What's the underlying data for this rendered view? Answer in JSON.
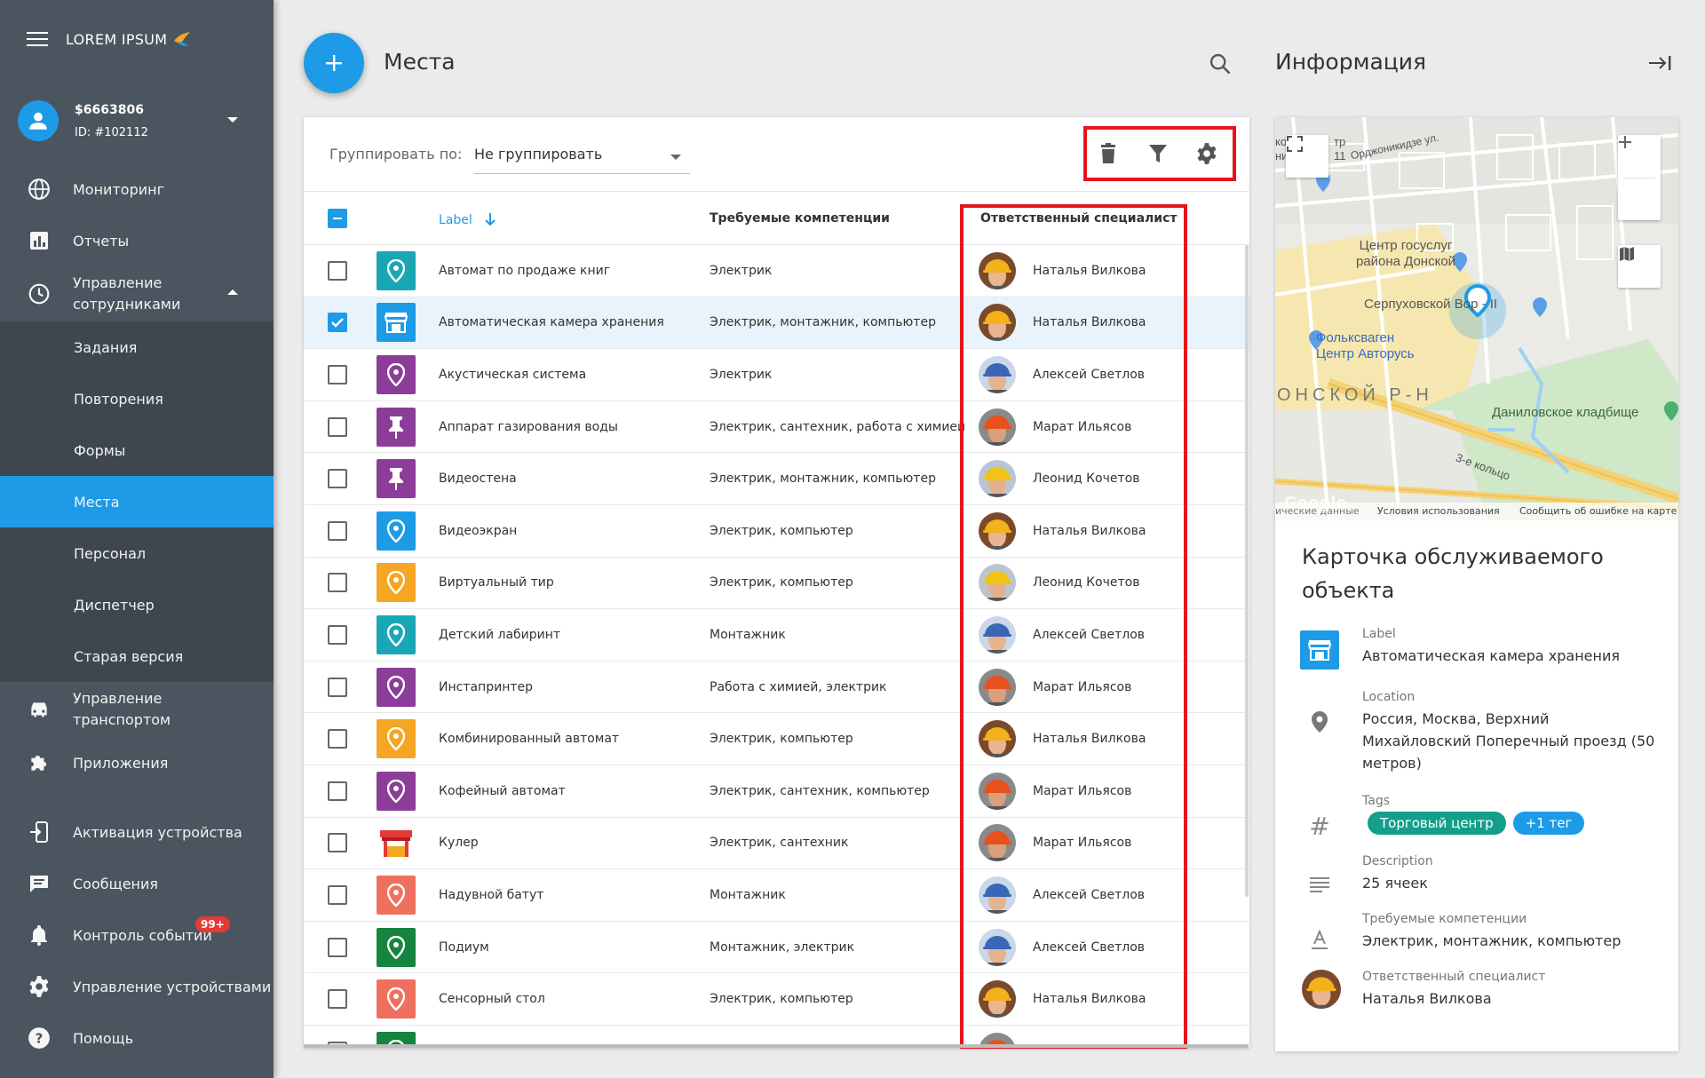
{
  "app": {
    "brand": "LOREM IPSUM"
  },
  "account": {
    "name": "$6663806",
    "id": "ID: #102112"
  },
  "nav": {
    "monitoring": "Мониторинг",
    "reports": "Отчеты",
    "staff": "Управление сотрудниками",
    "tasks": "Задания",
    "repeats": "Повторения",
    "forms": "Формы",
    "places": "Места",
    "personnel": "Персонал",
    "dispatcher": "Диспетчер",
    "old": "Старая версия",
    "transport": "Управление транспортом",
    "apps": "Приложения",
    "activation": "Активация устройства",
    "messages": "Сообщения",
    "events": "Контроль событий",
    "events_badge": "99+",
    "devices": "Управление устройствами",
    "help": "Помощь"
  },
  "header": {
    "title": "Места",
    "info_title": "Информация"
  },
  "toolbar": {
    "group_label": "Группировать по:",
    "group_value": "Не группировать"
  },
  "table": {
    "col_label": "Label",
    "col_comp": "Требуемые компетенции",
    "col_spec": "Ответственный специалист",
    "rows": [
      {
        "label": "Автомат по продаже книг",
        "comp": "Электрик",
        "spec": "Наталья Вилкова",
        "color": "#1aa7b5",
        "icon": "pin",
        "ava": "natalia"
      },
      {
        "label": "Автоматическая камера хранения",
        "comp": "Электрик, монтажник, компьютер",
        "spec": "Наталья Вилкова",
        "color": "#1e9be6",
        "icon": "store",
        "ava": "natalia",
        "selected": true
      },
      {
        "label": "Акустическая система",
        "comp": "Электрик",
        "spec": "Алексей Светлов",
        "color": "#8b3d99",
        "icon": "pin",
        "ava": "alexey"
      },
      {
        "label": "Аппарат газирования воды",
        "comp": "Электрик, сантехник, работа с химией",
        "spec": "Марат Ильясов",
        "color": "#8b3d99",
        "icon": "pushpin",
        "ava": "marat"
      },
      {
        "label": "Видеостена",
        "comp": "Электрик, монтажник, компьютер",
        "spec": "Леонид Кочетов",
        "color": "#8b3d99",
        "icon": "pushpin",
        "ava": "leonid"
      },
      {
        "label": "Видеоэкран",
        "comp": "Электрик, компьютер",
        "spec": "Наталья Вилкова",
        "color": "#1e9be6",
        "icon": "pin",
        "ava": "natalia"
      },
      {
        "label": "Виртуальный тир",
        "comp": "Электрик, компьютер",
        "spec": "Леонид Кочетов",
        "color": "#f5a623",
        "icon": "pin",
        "ava": "leonid"
      },
      {
        "label": "Детский лабиринт",
        "comp": "Монтажник",
        "spec": "Алексей Светлов",
        "color": "#1aa7b5",
        "icon": "pin",
        "ava": "alexey"
      },
      {
        "label": "Инстапринтер",
        "comp": "Работа с химией, электрик",
        "spec": "Марат Ильясов",
        "color": "#8b3d99",
        "icon": "pin",
        "ava": "marat"
      },
      {
        "label": "Комбинированный автомат",
        "comp": "Электрик, компьютер",
        "spec": "Наталья Вилкова",
        "color": "#f5a623",
        "icon": "pin",
        "ava": "natalia"
      },
      {
        "label": "Кофейный автомат",
        "comp": "Электрик, сантехник, компьютер",
        "spec": "Марат Ильясов",
        "color": "#8b3d99",
        "icon": "pin",
        "ava": "marat"
      },
      {
        "label": "Кулер",
        "comp": "Электрик, сантехник",
        "spec": "Марат Ильясов",
        "color": "#ffffff",
        "icon": "booth",
        "ava": "marat"
      },
      {
        "label": "Надувной батут",
        "comp": "Монтажник",
        "spec": "Алексей Светлов",
        "color": "#f07060",
        "icon": "pin",
        "ava": "alexey"
      },
      {
        "label": "Подиум",
        "comp": "Монтажник, электрик",
        "spec": "Алексей Светлов",
        "color": "#14843f",
        "icon": "pin",
        "ava": "alexey"
      },
      {
        "label": "Сенсорный стол",
        "comp": "Электрик, компьютер",
        "spec": "Наталья Вилкова",
        "color": "#f07060",
        "icon": "pin",
        "ava": "natalia"
      }
    ]
  },
  "map": {
    "labels": [
      "Центр госуслуг района Донской",
      "Серпуховской Вор - II",
      "Фольксваген Центр Авторусь",
      "ОНСКОЙ Р-Н",
      "Даниловское кладбище",
      "3-е кольцо",
      "Орджоникидзе ул.",
      "кон",
      "тр",
      "ник",
      "11"
    ],
    "footer_data": "ические данные",
    "footer_terms": "Условия использования",
    "footer_report": "Сообщить об ошибке на карте",
    "google": "Google"
  },
  "card": {
    "title": "Карточка обслуживаемого объекта",
    "label_key": "Label",
    "label_val": "Автоматическая камера хранения",
    "loc_key": "Location",
    "loc_val": "Россия, Москва, Верхний Михайловский Поперечный проезд (50 метров)",
    "tags_key": "Tags",
    "tag1": "Торговый центр",
    "tag2": "+1 тег",
    "desc_key": "Description",
    "desc_val": "25 ячеек",
    "comp_key": "Требуемые компетенции",
    "comp_val": "Электрик, монтажник, компьютер",
    "spec_key": "Ответственный специалист",
    "spec_val": "Наталья Вилкова"
  },
  "colors": {
    "accent": "#1e9be6",
    "sidebar": "#4b5560",
    "highlight": "#e8141b",
    "tag1": "#139f8b",
    "tag2": "#1e9be6"
  }
}
